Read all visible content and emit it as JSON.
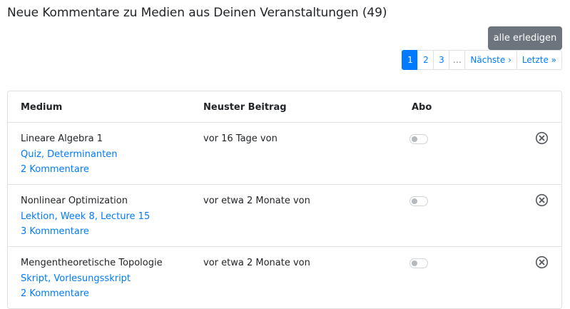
{
  "page": {
    "title": "Neue Kommentare zu Medien aus Deinen Veranstaltungen (49)",
    "done_all_label": "alle erledigen"
  },
  "pagination": {
    "items": [
      "1",
      "2",
      "3",
      "…",
      "Nächste ›",
      "Letzte »"
    ],
    "active": "1"
  },
  "table": {
    "headers": {
      "medium": "Medium",
      "latest_post": "Neuster Beitrag",
      "subscription": "Abo"
    },
    "rows": [
      {
        "title": "Lineare Algebra 1",
        "link": "Quiz, Determinanten",
        "comments": "2 Kommentare",
        "latest": "vor 16 Tage von",
        "subscribed": false,
        "toggle_icon": "toggle-off-icon",
        "close_icon": "close-circle-icon"
      },
      {
        "title": "Nonlinear Optimization",
        "link": "Lektion, Week 8, Lecture 15",
        "comments": "3 Kommentare",
        "latest": "vor etwa 2 Monate von",
        "subscribed": false,
        "toggle_icon": "toggle-off-icon",
        "close_icon": "close-circle-icon"
      },
      {
        "title": "Mengentheoretische Topologie",
        "link": "Skript, Vorlesungsskript",
        "comments": "2 Kommentare",
        "latest": "vor etwa 2 Monate von",
        "subscribed": false,
        "toggle_icon": "toggle-off-icon",
        "close_icon": "close-circle-icon"
      }
    ]
  },
  "colors": {
    "link": "#007bff",
    "button_secondary": "#6c757d",
    "active_page": "#007bff"
  }
}
